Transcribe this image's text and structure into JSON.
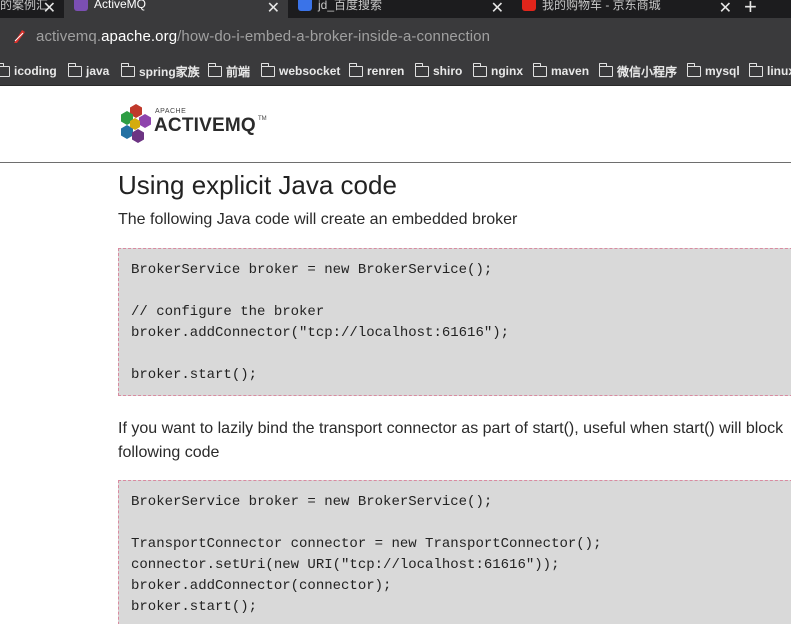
{
  "browser": {
    "tabs": [
      {
        "label": "的案例汇",
        "favicon_color": "#5a5a5a",
        "active": false
      },
      {
        "label": "ActiveMQ",
        "favicon_color": "#7b4fb3",
        "active": true
      },
      {
        "label": "jd_百度搜索",
        "favicon_color": "#3a73e8",
        "active": false
      },
      {
        "label": "我的购物车 - 京东商城",
        "favicon_color": "#e1251b",
        "active": false
      }
    ],
    "new_tab_label": "+",
    "close_glyph": "✕",
    "url": {
      "prefix": "activemq.",
      "host": "apache.org",
      "path": "/how-do-i-embed-a-broker-inside-a-connection"
    },
    "bookmarks": [
      "icoding",
      "java",
      "spring家族",
      "前端",
      "websocket",
      "renren",
      "shiro",
      "nginx",
      "maven",
      "微信小程序",
      "mysql",
      "linux"
    ]
  },
  "logo": {
    "apache": "APACHE",
    "name": "ACTIVEMQ",
    "tm": "TM"
  },
  "content": {
    "title": "Using explicit Java code",
    "intro": "The following Java code will create an embedded broker",
    "code1": [
      "BrokerService broker = new BrokerService();",
      "",
      "// configure the broker",
      "broker.addConnector(\"tcp://localhost:61616\");",
      "",
      "broker.start();"
    ],
    "lazy_line1": "If you want to lazily bind the transport connector as part of start(), useful when start() will block",
    "lazy_line2": "following code",
    "code2": [
      "BrokerService broker = new BrokerService();",
      "",
      "TransportConnector connector = new TransportConnector();",
      "connector.setUri(new URI(\"tcp://localhost:61616\"));",
      "broker.addConnector(connector);",
      "broker.start();"
    ]
  }
}
